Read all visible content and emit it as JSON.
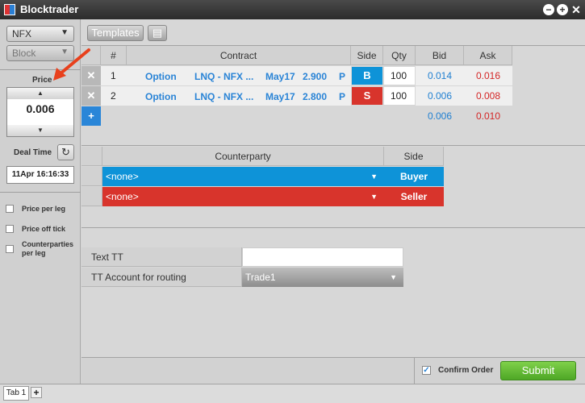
{
  "window": {
    "title": "Blocktrader",
    "minimize": "−",
    "maximize": "+",
    "close": "✕"
  },
  "left": {
    "exchange": "NFX",
    "type": "Block",
    "price_label": "Price",
    "price_value": "0.006",
    "deal_time_label": "Deal Time",
    "deal_time_value": "11Apr 16:16:33",
    "checkboxes": [
      {
        "label": "Price per leg"
      },
      {
        "label": "Price off tick"
      },
      {
        "label": "Counterparties per leg"
      }
    ]
  },
  "toolbar": {
    "templates_label": "Templates"
  },
  "legs": {
    "headers": {
      "num": "#",
      "contract": "Contract",
      "side": "Side",
      "qty": "Qty",
      "bid": "Bid",
      "ask": "Ask"
    },
    "rows": [
      {
        "num": "1",
        "type": "Option",
        "name": "LNQ - NFX ...",
        "expiry": "May17",
        "strike": "2.900",
        "cp": "P",
        "side": "B",
        "qty": "100",
        "bid": "0.014",
        "ask": "0.016"
      },
      {
        "num": "2",
        "type": "Option",
        "name": "LNQ - NFX ...",
        "expiry": "May17",
        "strike": "2.800",
        "cp": "P",
        "side": "S",
        "qty": "100",
        "bid": "0.006",
        "ask": "0.008"
      }
    ],
    "totals": {
      "bid": "0.006",
      "ask": "0.010"
    },
    "remove_symbol": "✕",
    "add_symbol": "+"
  },
  "counterparty": {
    "headers": {
      "counterparty": "Counterparty",
      "side": "Side"
    },
    "rows": [
      {
        "value": "<none>",
        "side": "Buyer"
      },
      {
        "value": "<none>",
        "side": "Seller"
      }
    ]
  },
  "tt": {
    "text_label": "Text TT",
    "text_value": "",
    "account_label": "TT Account for routing",
    "account_value": "Trade1"
  },
  "footer": {
    "confirm_label": "Confirm Order",
    "submit_label": "Submit"
  },
  "tabs": {
    "tab1": "Tab 1",
    "add": "+"
  },
  "colors": {
    "buy": "#0e93d8",
    "sell": "#d8342c",
    "submit": "#5cb531",
    "link": "#2a84d6"
  }
}
